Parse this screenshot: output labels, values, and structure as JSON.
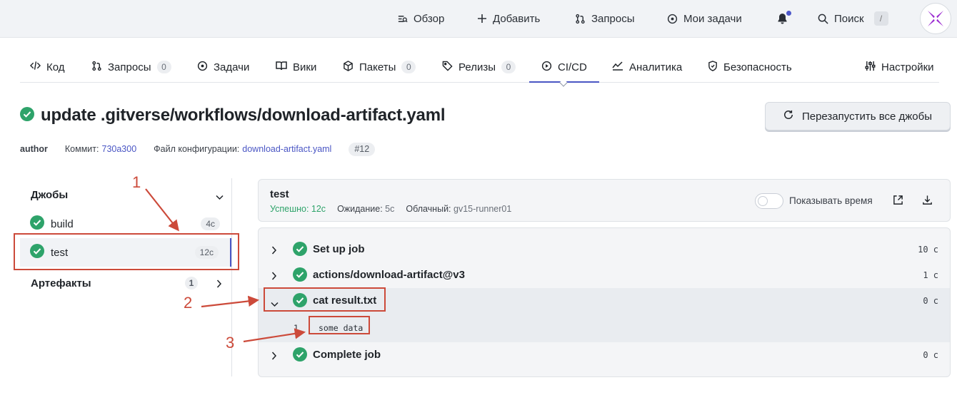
{
  "colors": {
    "accent": "#4a56c4",
    "success": "#2ea36a",
    "annotation": "#cc4a3a"
  },
  "topbar": {
    "overview": "Обзор",
    "add": "Добавить",
    "requests": "Запросы",
    "my_tasks": "Мои задачи",
    "search": "Поиск",
    "search_shortcut": "/"
  },
  "repo_nav": {
    "tabs": [
      {
        "label": "Код",
        "icon": "code-icon"
      },
      {
        "label": "Запросы",
        "badge": "0",
        "icon": "pull-request-icon"
      },
      {
        "label": "Задачи",
        "icon": "issue-icon"
      },
      {
        "label": "Вики",
        "icon": "book-icon"
      },
      {
        "label": "Пакеты",
        "badge": "0",
        "icon": "package-icon"
      },
      {
        "label": "Релизы",
        "badge": "0",
        "icon": "tag-icon"
      },
      {
        "label": "CI/CD",
        "icon": "play-icon",
        "active": true
      },
      {
        "label": "Аналитика",
        "icon": "graph-icon"
      },
      {
        "label": "Безопасность",
        "icon": "shield-icon"
      },
      {
        "label": "Настройки",
        "icon": "settings-icon"
      }
    ]
  },
  "run": {
    "title": "update .gitverse/workflows/download-artifact.yaml",
    "rerun_label": "Перезапустить все джобы",
    "author": "author",
    "commit_label": "Коммит:",
    "commit_hash": "730a300",
    "config_label": "Файл конфигурации:",
    "config_file": "download-artifact.yaml",
    "run_number": "#12"
  },
  "sidebar": {
    "jobs_title": "Джобы",
    "jobs": [
      {
        "name": "build",
        "duration": "4с"
      },
      {
        "name": "test",
        "duration": "12с"
      }
    ],
    "artifacts_title": "Артефакты",
    "artifacts_count": "1"
  },
  "job": {
    "name": "test",
    "status": "Успешно: 12с",
    "wait_label": "Ожидание:",
    "wait_value": "5с",
    "runner_label": "Облачный:",
    "runner_value": "gv15-runner01",
    "show_time_label": "Показывать время",
    "steps": [
      {
        "name": "Set up job",
        "duration": "10 с"
      },
      {
        "name": "actions/download-artifact@v3",
        "duration": "1 с"
      },
      {
        "name": "cat result.txt",
        "duration": "0 с"
      },
      {
        "name": "Complete job",
        "duration": "0 с"
      }
    ],
    "log": {
      "line_number": "1",
      "text": "some data"
    }
  },
  "annotations": [
    "1",
    "2",
    "3"
  ]
}
